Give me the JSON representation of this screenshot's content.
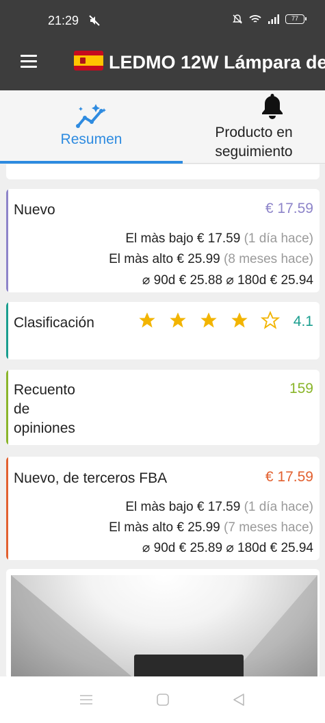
{
  "status_bar": {
    "time": "21:29",
    "battery": "77",
    "icons": [
      "mute-icon",
      "do-not-disturb-icon",
      "wifi-icon",
      "signal-icon",
      "battery-icon"
    ]
  },
  "app_bar": {
    "flag_country": "Spain",
    "title": "LEDMO 12W Lámpara de"
  },
  "tabs": [
    {
      "label": "Resumen",
      "icon": "chart-sparkle-icon",
      "active": true
    },
    {
      "label": "Producto en seguimiento",
      "icon": "bell-icon",
      "active": false
    }
  ],
  "cards": {
    "nuevo": {
      "title": "Nuevo",
      "price": "€ 17.59",
      "low_label": "El màs bajo",
      "low_price": "€ 17.59",
      "low_ago": "(1 día hace)",
      "high_label": "El màs alto",
      "high_price": "€ 25.99",
      "high_ago": "(8 meses hace)",
      "avg90_label": "⌀ 90d",
      "avg90": "€ 25.88",
      "avg180_label": "⌀ 180d",
      "avg180": "€ 25.94",
      "accent": "#8d84c9"
    },
    "rating": {
      "title": "Clasificación",
      "value": "4.1",
      "stars_filled": 4,
      "stars_total": 5,
      "accent": "#1a9e8f"
    },
    "reviews": {
      "title": "Recuento de opiniones",
      "value": "159",
      "accent": "#8ab52a"
    },
    "fba": {
      "title": "Nuevo, de terceros FBA",
      "price": "€ 17.59",
      "low_label": "El màs bajo",
      "low_price": "€ 17.59",
      "low_ago": "(1 día hace)",
      "high_label": "El màs alto",
      "high_price": "€ 25.99",
      "high_ago": "(7 meses hace)",
      "avg90_label": "⌀ 90d",
      "avg90": "€ 25.89",
      "avg180_label": "⌀ 180d",
      "avg180": "€ 25.94",
      "accent": "#e2602f"
    }
  },
  "colors": {
    "app_bar": "#3d3d3d",
    "tab_active": "#2e8be0",
    "star": "#f2b400"
  }
}
